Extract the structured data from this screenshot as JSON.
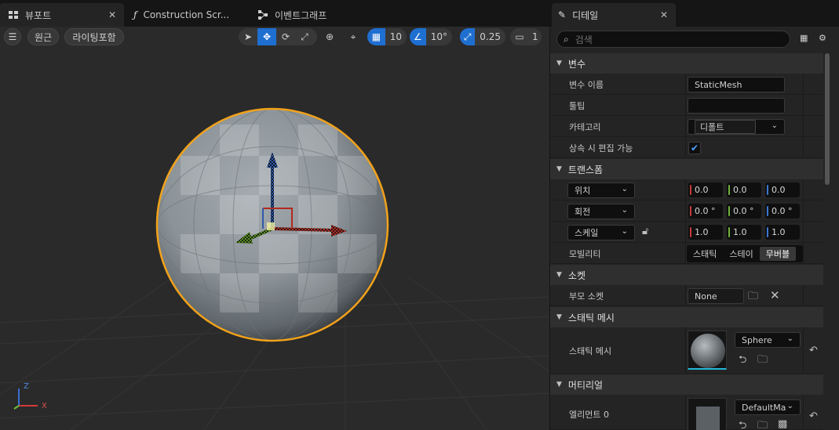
{
  "tabs": {
    "viewport": "뷰포트",
    "construction": "Construction Scr...",
    "eventgraph": "이벤트그래프",
    "close": "✕"
  },
  "viewport_toolbar": {
    "menu_icon": "☰",
    "perspective": "원근",
    "lighting": "라이팅포함",
    "grid_snap_value": "10",
    "rotation_snap_value": "10°",
    "scale_snap_value": "0.25",
    "camera_speed": "1"
  },
  "axis_labels": {
    "x": "X",
    "z": "Z"
  },
  "details": {
    "title": "디테일",
    "close": "✕",
    "search_placeholder": "검색",
    "sections": {
      "variables": "변수",
      "transform": "트랜스폼",
      "sockets": "소켓",
      "static_mesh": "스태틱 메시",
      "materials": "머티리얼"
    },
    "variables": {
      "name_label": "변수 이름",
      "name_value": "StaticMesh",
      "tooltip_label": "툴팁",
      "tooltip_value": "",
      "category_label": "카테고리",
      "category_value": "디폴트",
      "editable_label": "상속 시 편집 가능",
      "editable_checked": true
    },
    "transform": {
      "location_label": "위치",
      "location": [
        "0.0",
        "0.0",
        "0.0"
      ],
      "rotation_label": "회전",
      "rotation": [
        "0.0 °",
        "0.0 °",
        "0.0 °"
      ],
      "scale_label": "스케일",
      "scale": [
        "1.0",
        "1.0",
        "1.0"
      ],
      "mobility_label": "모빌리티",
      "mobility_options": [
        "스태틱",
        "스테이",
        "무버블"
      ],
      "mobility_selected": "무버블"
    },
    "sockets": {
      "parent_label": "부모 소켓",
      "parent_value": "None"
    },
    "static_mesh": {
      "label": "스태틱 메시",
      "value": "Sphere"
    },
    "materials": {
      "element_label": "엘리먼트 0",
      "value": "DefaultMa"
    }
  }
}
